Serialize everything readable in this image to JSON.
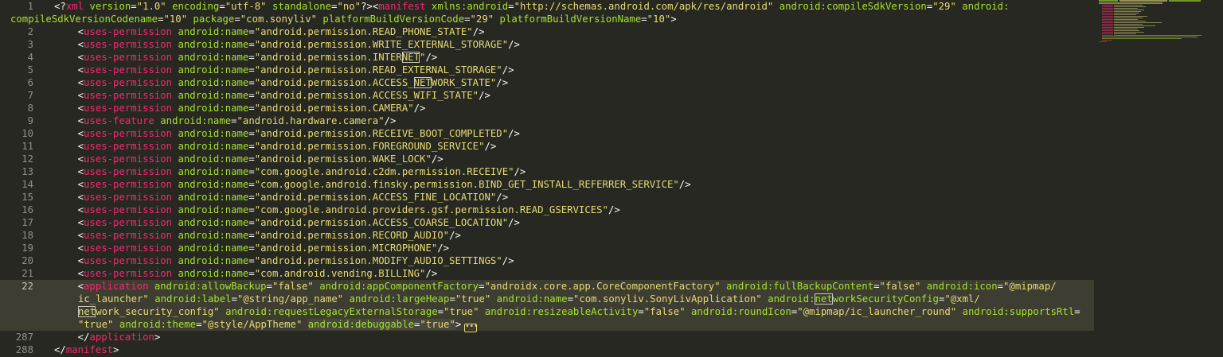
{
  "gutter": {
    "line_numbers": [
      "1",
      "2",
      "3",
      "4",
      "5",
      "6",
      "7",
      "8",
      "9",
      "10",
      "11",
      "12",
      "13",
      "14",
      "15",
      "16",
      "17",
      "18",
      "19",
      "20",
      "21",
      "22",
      "287",
      "288"
    ],
    "active_line": "22"
  },
  "code": {
    "l1a_decl_open": "<?",
    "l1a_xml": "xml",
    "l1a_sp1": " ",
    "l1a_version_attr": "version",
    "l1a_eq1": "=",
    "l1a_version_val": "\"1.0\"",
    "l1a_sp2": " ",
    "l1a_encoding_attr": "encoding",
    "l1a_eq2": "=",
    "l1a_encoding_val": "\"utf-8\"",
    "l1a_sp3": " ",
    "l1a_standalone_attr": "standalone",
    "l1a_eq3": "=",
    "l1a_standalone_val": "\"no\"",
    "l1a_decl_close": "?><",
    "l1a_manifest": "manifest",
    "l1a_sp4": " ",
    "l1a_xmlns_attr": "xmlns:android",
    "l1a_eq4": "=",
    "l1a_xmlns_val": "\"http://schemas.android.com/apk/res/android\"",
    "l1a_sp5": " ",
    "l1a_csv_attr": "android:compileSdkVersion",
    "l1a_eq5": "=",
    "l1a_csv_val": "\"29\"",
    "l1a_sp6": " ",
    "l1a_android_trail": "android:",
    "l1b_csvc_attr": "compileSdkVersionCodename",
    "l1b_eq1": "=",
    "l1b_csvc_val": "\"10\"",
    "l1b_sp1": " ",
    "l1b_package_attr": "package",
    "l1b_eq2": "=",
    "l1b_package_val": "\"com.sonyliv\"",
    "l1b_sp2": " ",
    "l1b_pbvc_attr": "platformBuildVersionCode",
    "l1b_eq3": "=",
    "l1b_pbvc_val": "\"29\"",
    "l1b_sp3": " ",
    "l1b_pbvn_attr": "platformBuildVersionName",
    "l1b_eq4": "=",
    "l1b_pbvn_val": "\"10\"",
    "l1b_close": ">",
    "lines": [
      {
        "indent": "    ",
        "tag": "uses-permission",
        "attr": "android:name",
        "val_pre": "\"android.permission.READ_PHONE_STATE\"",
        "val_box": "",
        "val_post": ""
      },
      {
        "indent": "    ",
        "tag": "uses-permission",
        "attr": "android:name",
        "val_pre": "\"android.permission.WRITE_EXTERNAL_STORAGE\"",
        "val_box": "",
        "val_post": ""
      },
      {
        "indent": "    ",
        "tag": "uses-permission",
        "attr": "android:name",
        "val_pre": "\"android.permission.INTER",
        "val_box": "NET",
        "val_post": "\""
      },
      {
        "indent": "    ",
        "tag": "uses-permission",
        "attr": "android:name",
        "val_pre": "\"android.permission.READ_EXTERNAL_STORAGE\"",
        "val_box": "",
        "val_post": ""
      },
      {
        "indent": "    ",
        "tag": "uses-permission",
        "attr": "android:name",
        "val_pre": "\"android.permission.ACCESS_",
        "val_box": "NET",
        "val_post": "WORK_STATE\""
      },
      {
        "indent": "    ",
        "tag": "uses-permission",
        "attr": "android:name",
        "val_pre": "\"android.permission.ACCESS_WIFI_STATE\"",
        "val_box": "",
        "val_post": ""
      },
      {
        "indent": "    ",
        "tag": "uses-permission",
        "attr": "android:name",
        "val_pre": "\"android.permission.CAMERA\"",
        "val_box": "",
        "val_post": ""
      },
      {
        "indent": "    ",
        "tag": "uses-feature",
        "attr": "android:name",
        "val_pre": "\"android.hardware.camera\"",
        "val_box": "",
        "val_post": ""
      },
      {
        "indent": "    ",
        "tag": "uses-permission",
        "attr": "android:name",
        "val_pre": "\"android.permission.RECEIVE_BOOT_COMPLETED\"",
        "val_box": "",
        "val_post": ""
      },
      {
        "indent": "    ",
        "tag": "uses-permission",
        "attr": "android:name",
        "val_pre": "\"android.permission.FOREGROUND_SERVICE\"",
        "val_box": "",
        "val_post": ""
      },
      {
        "indent": "    ",
        "tag": "uses-permission",
        "attr": "android:name",
        "val_pre": "\"android.permission.WAKE_LOCK\"",
        "val_box": "",
        "val_post": ""
      },
      {
        "indent": "    ",
        "tag": "uses-permission",
        "attr": "android:name",
        "val_pre": "\"com.google.android.c2dm.permission.RECEIVE\"",
        "val_box": "",
        "val_post": ""
      },
      {
        "indent": "    ",
        "tag": "uses-permission",
        "attr": "android:name",
        "val_pre": "\"com.google.android.finsky.permission.BIND_GET_INSTALL_REFERRER_SERVICE\"",
        "val_box": "",
        "val_post": ""
      },
      {
        "indent": "    ",
        "tag": "uses-permission",
        "attr": "android:name",
        "val_pre": "\"android.permission.ACCESS_FINE_LOCATION\"",
        "val_box": "",
        "val_post": ""
      },
      {
        "indent": "    ",
        "tag": "uses-permission",
        "attr": "android:name",
        "val_pre": "\"com.google.android.providers.gsf.permission.READ_GSERVICES\"",
        "val_box": "",
        "val_post": ""
      },
      {
        "indent": "    ",
        "tag": "uses-permission",
        "attr": "android:name",
        "val_pre": "\"android.permission.ACCESS_COARSE_LOCATION\"",
        "val_box": "",
        "val_post": ""
      },
      {
        "indent": "    ",
        "tag": "uses-permission",
        "attr": "android:name",
        "val_pre": "\"android.permission.RECORD_AUDIO\"",
        "val_box": "",
        "val_post": ""
      },
      {
        "indent": "    ",
        "tag": "uses-permission",
        "attr": "android:name",
        "val_pre": "\"android.permission.MICROPHONE\"",
        "val_box": "",
        "val_post": ""
      },
      {
        "indent": "    ",
        "tag": "uses-permission",
        "attr": "android:name",
        "val_pre": "\"android.permission.MODIFY_AUDIO_SETTINGS\"",
        "val_box": "",
        "val_post": ""
      },
      {
        "indent": "    ",
        "tag": "uses-permission",
        "attr": "android:name",
        "val_pre": "\"com.android.vending.BILLING\"",
        "val_box": "",
        "val_post": ""
      }
    ],
    "l22a_open": "<",
    "l22a_tag": "application",
    "l22a_a1": "android:allowBackup",
    "l22a_v1": "\"false\"",
    "l22a_a2": "android:appComponentFactory",
    "l22a_v2": "\"androidx.core.app.CoreComponentFactory\"",
    "l22a_a3": "android:fullBackupContent",
    "l22a_v3": "\"false\"",
    "l22a_a4": "android:icon",
    "l22a_v4": "\"@mipmap/",
    "l22b_v4": "ic_launcher\"",
    "l22b_a5": "android:label",
    "l22b_v5": "\"@string/app_name\"",
    "l22b_a6": "android:largeHeap",
    "l22b_v6": "\"true\"",
    "l22b_a7": "android:name",
    "l22b_v7": "\"com.sonyliv.SonyLivApplication\"",
    "l22b_a8_pre": "android:",
    "l22b_a8_box": "net",
    "l22b_a8_post": "workSecurityConfig",
    "l22b_v8": "\"@xml/",
    "l22c_v8_box": "net",
    "l22c_v8_post": "work_security_config\"",
    "l22c_a9": "android:requestLegacyExternalStorage",
    "l22c_v9": "\"true\"",
    "l22c_a10": "android:resizeableActivity",
    "l22c_v10": "\"false\"",
    "l22c_a11": "android:roundIcon",
    "l22c_v11": "\"@mipmap/ic_launcher_round\"",
    "l22c_a12": "android:supportsRtl",
    "l22c_eq12": "=",
    "l22d_v12": "\"true\"",
    "l22d_a13": "android:theme",
    "l22d_v13": "\"@style/AppTheme\"",
    "l22d_a14": "android:debuggable",
    "l22d_v14": "\"true\"",
    "l22d_close": ">",
    "l22d_fold": "•••",
    "l287_indent": "    ",
    "l287_open": "</",
    "l287_tag": "application",
    "l287_close": ">",
    "l288_open": "</",
    "l288_tag": "manifest",
    "l288_close": ">"
  },
  "colors": {
    "background": "#272822",
    "tag": "#f92672",
    "attribute": "#a6e22e",
    "string": "#e6db74",
    "text": "#f8f8f2",
    "line_number": "#90908a",
    "active_line": "#3e3d32"
  }
}
